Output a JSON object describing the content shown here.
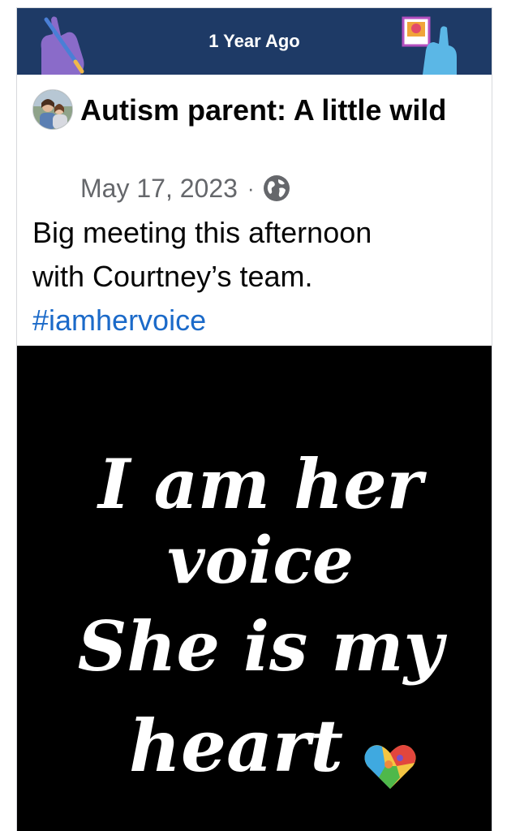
{
  "memory": {
    "title": "1 Year Ago"
  },
  "post": {
    "author": "Autism parent: A little wild",
    "date": "May 17, 2023",
    "separator": "·",
    "audience_icon": "globe-icon",
    "text_line1": "Big meeting this afternoon",
    "text_line2": "with Courtney’s team.",
    "hashtag": "#iamhervoice"
  },
  "image": {
    "line1": "I am her",
    "line2": "voice",
    "line3": "She is my",
    "line4": "heart",
    "heart_icon": "puzzle-heart-icon"
  },
  "colors": {
    "header_bg": "#1e3a66",
    "hashtag": "#1b6ac9",
    "meta": "#65676b",
    "image_bg": "#000000"
  }
}
